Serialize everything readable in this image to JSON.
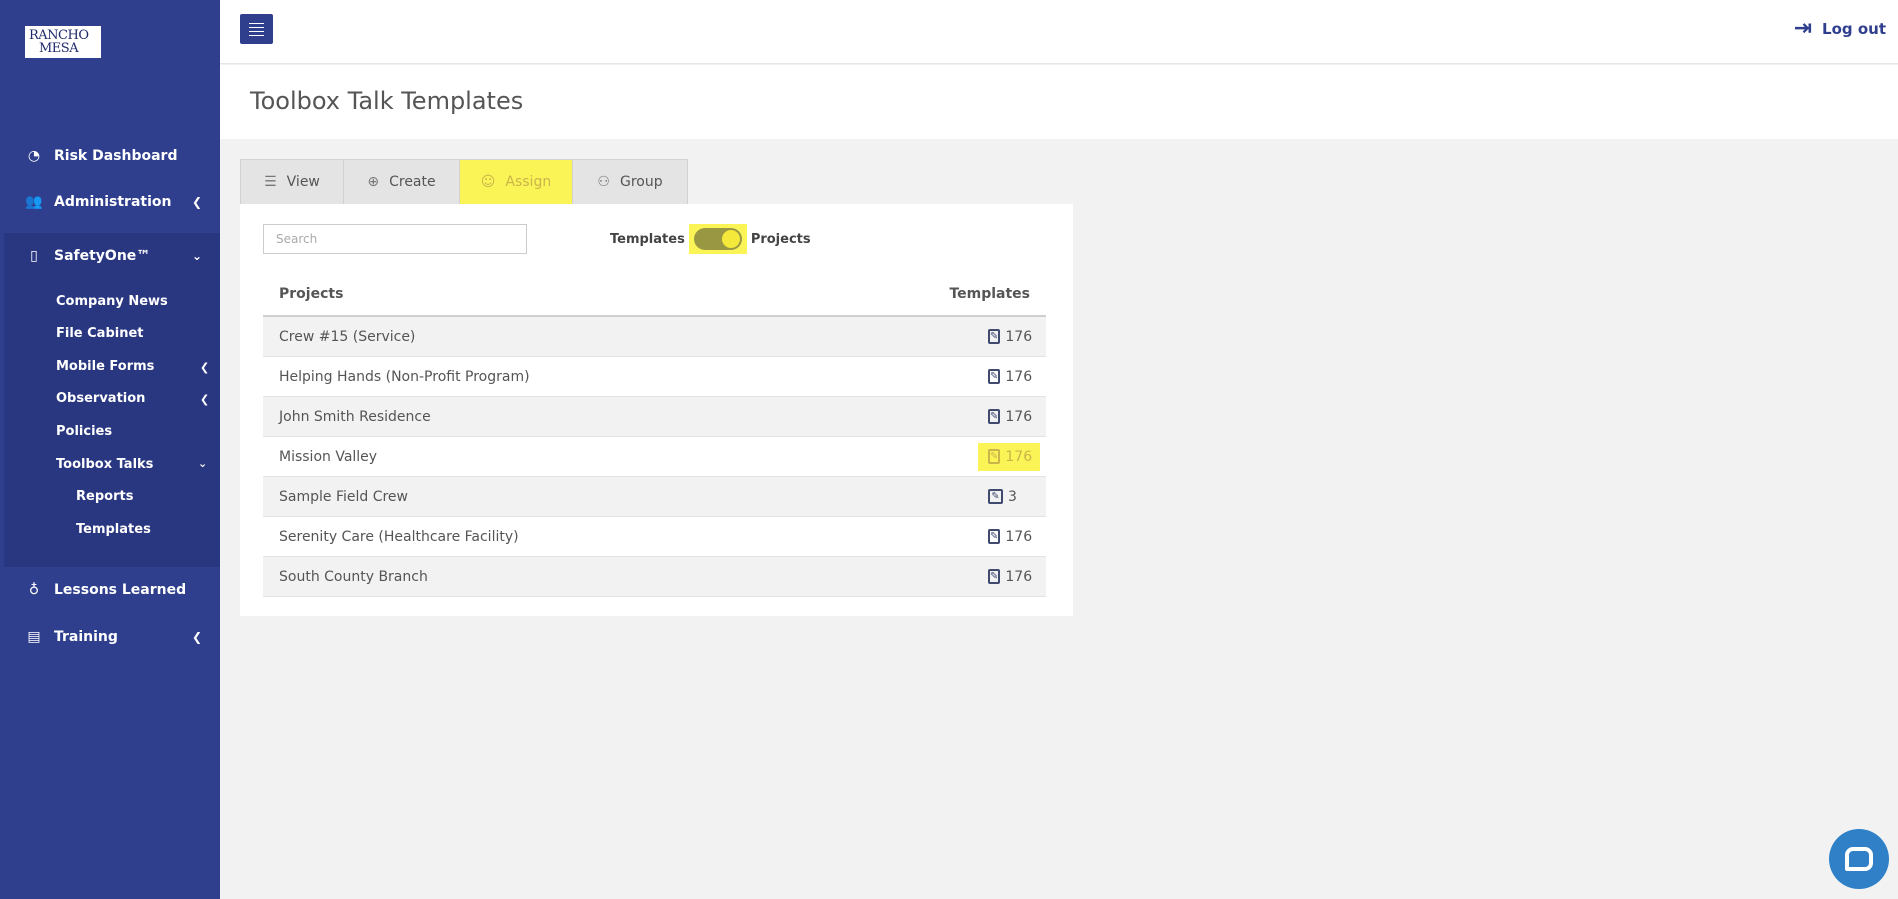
{
  "logo": {
    "line1": "RANCHO",
    "line2": "MESA"
  },
  "sidebar": {
    "items": [
      {
        "label": "Risk Dashboard",
        "icon": "dashboard-icon"
      },
      {
        "label": "Administration",
        "icon": "users-icon"
      },
      {
        "label": "SafetyOne™",
        "icon": "mobile-icon"
      },
      {
        "label": "Lessons Learned",
        "icon": "lightbulb-icon"
      },
      {
        "label": "Training",
        "icon": "training-icon"
      }
    ],
    "sub_items": [
      {
        "label": "Company News"
      },
      {
        "label": "File Cabinet"
      },
      {
        "label": "Mobile Forms"
      },
      {
        "label": "Observation"
      },
      {
        "label": "Policies"
      },
      {
        "label": "Toolbox Talks"
      }
    ],
    "subsub_items": [
      {
        "label": "Reports"
      },
      {
        "label": "Templates"
      }
    ]
  },
  "header": {
    "logout_label": "Log out"
  },
  "page": {
    "title": "Toolbox Talk Templates"
  },
  "tabs": [
    {
      "label": "View",
      "icon": "list-icon"
    },
    {
      "label": "Create",
      "icon": "plus-circle-icon"
    },
    {
      "label": "Assign",
      "icon": "user-icon"
    },
    {
      "label": "Group",
      "icon": "group-icon"
    }
  ],
  "search": {
    "placeholder": "Search"
  },
  "toggle": {
    "left_label": "Templates",
    "right_label": "Projects"
  },
  "table": {
    "headers": {
      "projects": "Projects",
      "templates": "Templates"
    },
    "rows": [
      {
        "name": "Crew #15 (Service)",
        "count": "176"
      },
      {
        "name": "Helping Hands (Non-Profit Program)",
        "count": "176"
      },
      {
        "name": "John Smith Residence",
        "count": "176"
      },
      {
        "name": "Mission Valley",
        "count": "176"
      },
      {
        "name": "Sample Field Crew",
        "count": "3"
      },
      {
        "name": "Serenity Care (Healthcare Facility)",
        "count": "176"
      },
      {
        "name": "South County Branch",
        "count": "176"
      }
    ]
  },
  "colors": {
    "sidebar": "#2f3f8e",
    "highlight": "#fbf456",
    "chat": "#2f80c7"
  }
}
